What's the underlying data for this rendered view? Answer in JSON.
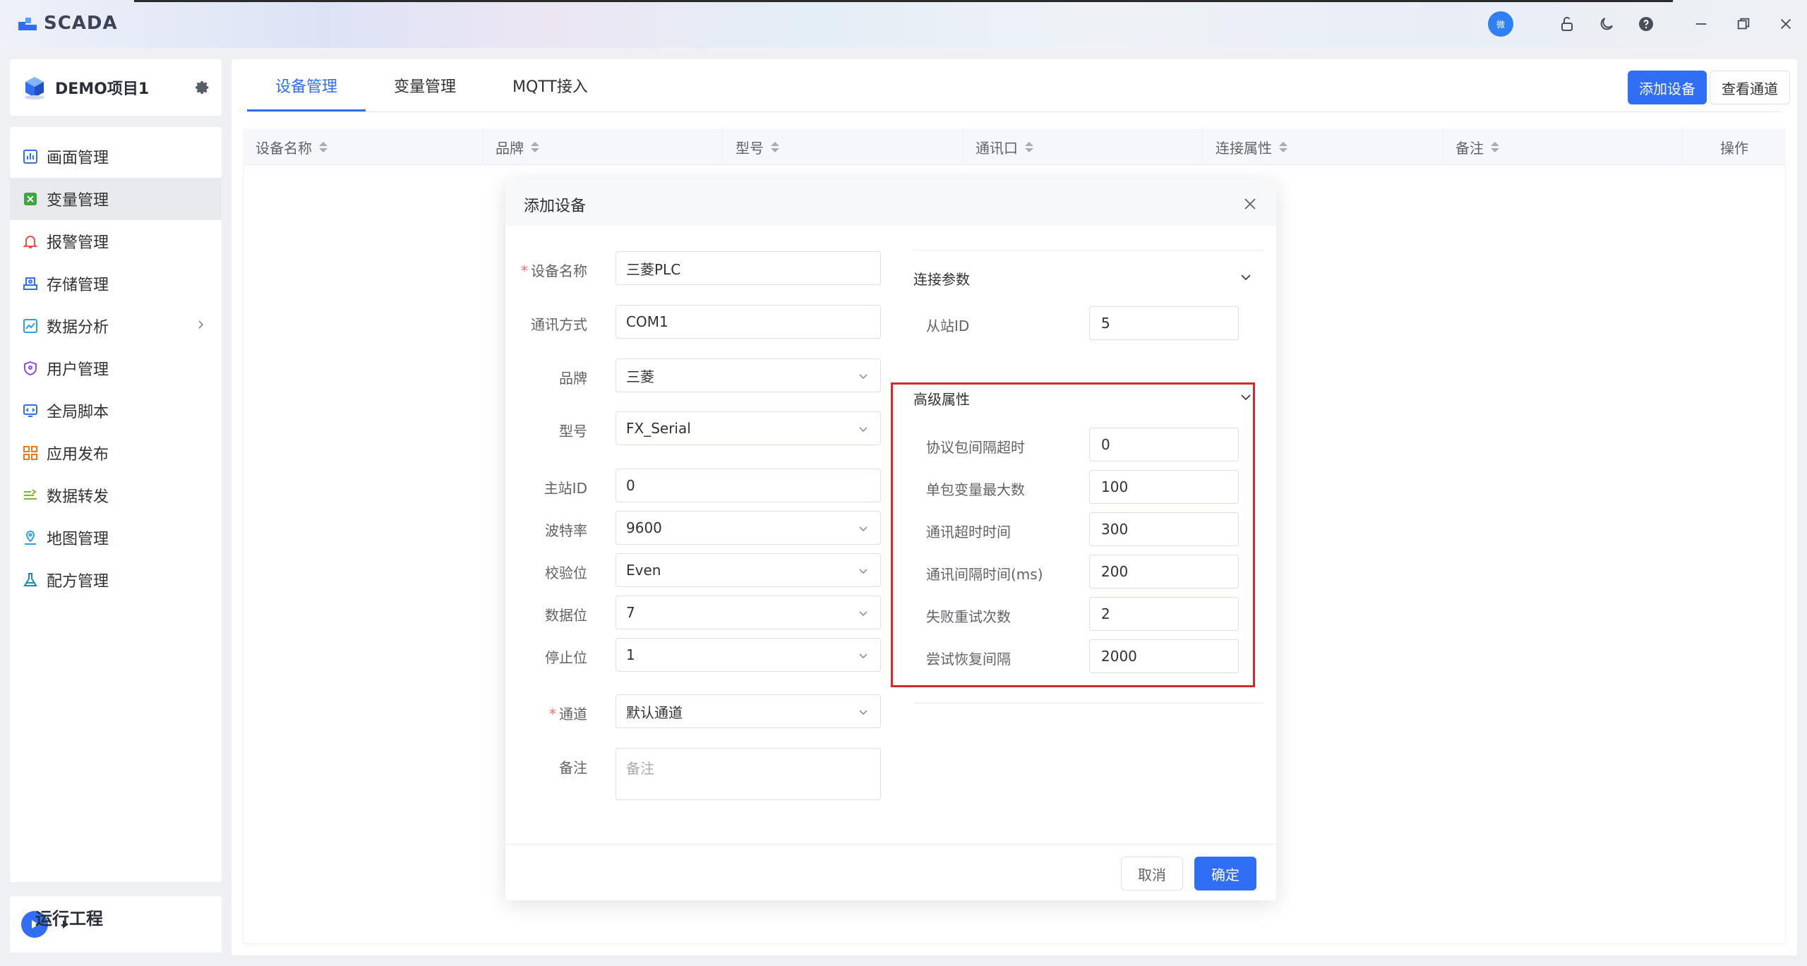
{
  "app": {
    "name": "SCADA",
    "avatar_text": "微"
  },
  "project": {
    "name": "DEMO项目1"
  },
  "sidebar": {
    "items": [
      {
        "label": "画面管理",
        "icon": "chart-bar-icon",
        "color": "#2f6ef5"
      },
      {
        "label": "变量管理",
        "icon": "variable-icon",
        "color": "#3aa83a"
      },
      {
        "label": "报警管理",
        "icon": "bell-icon",
        "color": "#f05050"
      },
      {
        "label": "存储管理",
        "icon": "storage-icon",
        "color": "#2f6ef5"
      },
      {
        "label": "数据分析",
        "icon": "analytics-icon",
        "color": "#2fa0e8"
      },
      {
        "label": "用户管理",
        "icon": "shield-icon",
        "color": "#8a4df0"
      },
      {
        "label": "全局脚本",
        "icon": "script-icon",
        "color": "#2f6ef5"
      },
      {
        "label": "应用发布",
        "icon": "grid-icon",
        "color": "#f07a1a"
      },
      {
        "label": "数据转发",
        "icon": "forward-icon",
        "color": "#7ab82a"
      },
      {
        "label": "地图管理",
        "icon": "map-icon",
        "color": "#2fa0e8"
      },
      {
        "label": "配方管理",
        "icon": "flask-icon",
        "color": "#1a8aa8"
      }
    ],
    "run_label": "运行工程"
  },
  "tabs": [
    "设备管理",
    "变量管理",
    "MQTT接入"
  ],
  "toolbar": {
    "add_device": "添加设备",
    "view_channel": "查看通道"
  },
  "table": {
    "columns": [
      "设备名称",
      "品牌",
      "型号",
      "通讯口",
      "连接属性",
      "备注"
    ],
    "op_column": "操作"
  },
  "dialog": {
    "title": "添加设备",
    "left_fields": [
      {
        "label": "设备名称",
        "value": "三菱PLC",
        "required": true
      },
      {
        "label": "通讯方式",
        "value": "COM1"
      },
      {
        "label": "品牌",
        "value": "三菱",
        "select": true
      },
      {
        "label": "型号",
        "value": "FX_Serial",
        "select": true
      },
      {
        "label": "主站ID",
        "value": "0"
      },
      {
        "label": "波特率",
        "value": "9600",
        "select": true
      },
      {
        "label": "校验位",
        "value": "Even",
        "select": true
      },
      {
        "label": "数据位",
        "value": "7",
        "select": true
      },
      {
        "label": "停止位",
        "value": "1",
        "select": true
      },
      {
        "label": "通道",
        "value": "默认通道",
        "select": true,
        "required": true
      }
    ],
    "remark": {
      "label": "备注",
      "placeholder": "备注"
    },
    "connection": {
      "title": "连接参数",
      "fields": [
        {
          "label": "从站ID",
          "value": "5"
        }
      ]
    },
    "advanced": {
      "title": "高级属性",
      "fields": [
        {
          "label": "协议包间隔超时",
          "value": "0"
        },
        {
          "label": "单包变量最大数",
          "value": "100"
        },
        {
          "label": "通讯超时时间",
          "value": "300"
        },
        {
          "label": "通讯间隔时间(ms)",
          "value": "200"
        },
        {
          "label": "失败重试次数",
          "value": "2"
        },
        {
          "label": "尝试恢复间隔",
          "value": "2000"
        }
      ]
    },
    "cancel": "取消",
    "ok": "确定"
  },
  "colors": {
    "primary": "#2f6ef5",
    "highlight": "#d42a2a",
    "required": "#f56c6c"
  }
}
